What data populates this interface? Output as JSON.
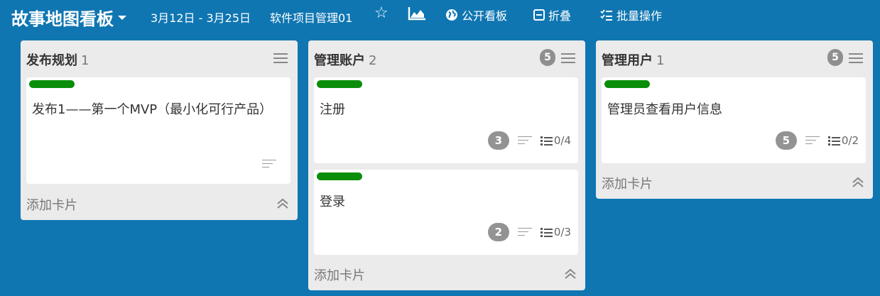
{
  "header": {
    "board_title": "故事地图看板",
    "sprint_range": "3月12日 - 3月25日",
    "project_name": "软件项目管理01",
    "public_label": "公开看板",
    "collapse_label": "折叠",
    "batch_label": "批量操作"
  },
  "colors": {
    "background": "#0f76b2",
    "label_green": "#0a8e0a",
    "list_bg": "#ebebeb"
  },
  "lists": [
    {
      "title": "发布规划",
      "count": "1",
      "add_card": "添加卡片",
      "cards": [
        {
          "title": "发布1——第一个MVP（最小化可行产品）"
        }
      ]
    },
    {
      "title": "管理账户",
      "count": "2",
      "badge": "5",
      "add_card": "添加卡片",
      "cards": [
        {
          "title": "注册",
          "points": "3",
          "checklist": "0/4"
        },
        {
          "title": "登录",
          "points": "2",
          "checklist": "0/3"
        }
      ]
    },
    {
      "title": "管理用户",
      "count": "1",
      "badge": "5",
      "add_card": "添加卡片",
      "cards": [
        {
          "title": "管理员查看用户信息",
          "points": "5",
          "checklist": "0/2"
        }
      ]
    }
  ]
}
